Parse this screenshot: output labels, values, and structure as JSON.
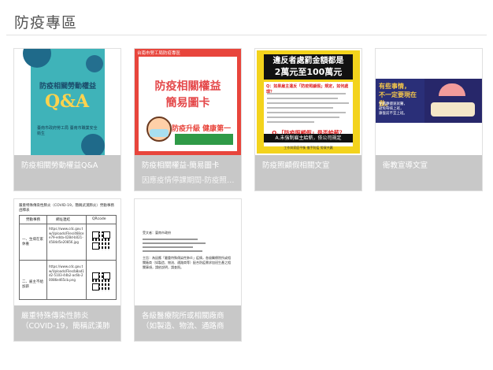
{
  "page": {
    "title": "防疫專區"
  },
  "cards": [
    {
      "caption": "防疫相關勞動權益Q&A",
      "subtitle": "",
      "thumb": {
        "heading": "防疫相關勞動權益",
        "qa": "Q&A",
        "footer": "臺南市政府勞工局\n臺南市職業安全衛生"
      }
    },
    {
      "caption": "防疫相關權益-簡易圖卡",
      "subtitle": "因應疫情停課期間-防疫照顧假",
      "thumb": {
        "badge": "台南市勞工局防疫專區",
        "title_line1": "防疫相關權益",
        "title_line2": "簡易圖卡",
        "slogan": "防疫升級 健康第一"
      }
    },
    {
      "caption": "防疫照顧假相關文宣",
      "subtitle": "",
      "thumb": {
        "banner_line1": "違反者處罰金額都是",
        "banner_line2": "2萬元至100萬元",
        "question1": "Q：如果雇主違反「防疫照顧假」規定，如何處理？",
        "question2": "Q.「防疫照顧假」是否給薪？",
        "answer": "A.未強制雇主給薪，依公司規定",
        "footer": "工作與家庭平衡 攜手防疫 勞資共贏"
      }
    },
    {
      "caption": "衛教宣導文宣",
      "subtitle": "",
      "thumb": {
        "line1": "有些事情，",
        "line2": "不一定要現在做。",
        "body": "生病應儘速就醫，\n避免帶病上班，\n康復前不宜上班。"
      }
    },
    {
      "caption_line1": "嚴重特殊傳染性肺炎",
      "caption_line2": "（COVID-19，簡稱武漢肺",
      "thumb": {
        "doc_title": "嚴重特殊傳染性肺炎（COVID-19，簡稱武漢肺炎）勞動事務函釋表",
        "headers": [
          "勞動事務",
          "網址連結",
          "QRcode"
        ],
        "rows": [
          {
            "topic": "一、生病在家休養",
            "link": "https://www.cdc.gov.tw/Uploads/Files/468cee79-edda-428d-b021-4584d5e20856.jpg"
          },
          {
            "topic": "二、雇主不給加薪",
            "link": "https://www.cdc.gov.tw/Uploads/Files/b8ad1d2-5103-44b2-ac6b-20086e465cb.png"
          }
        ]
      }
    },
    {
      "caption_line1": "各級醫療院所或相關廠商",
      "caption_line2": "（如製造、物流、通路商",
      "thumb": {
        "heading": "受文者：臺南市政府",
        "body": "主旨：為因應「嚴重特殊傳染性肺炎」疫情，各級醫療院所或相關廠商（如製造、物流、通路商等）配合防疫需求加班生產之相關事項，請依說明，請查照。"
      }
    }
  ]
}
